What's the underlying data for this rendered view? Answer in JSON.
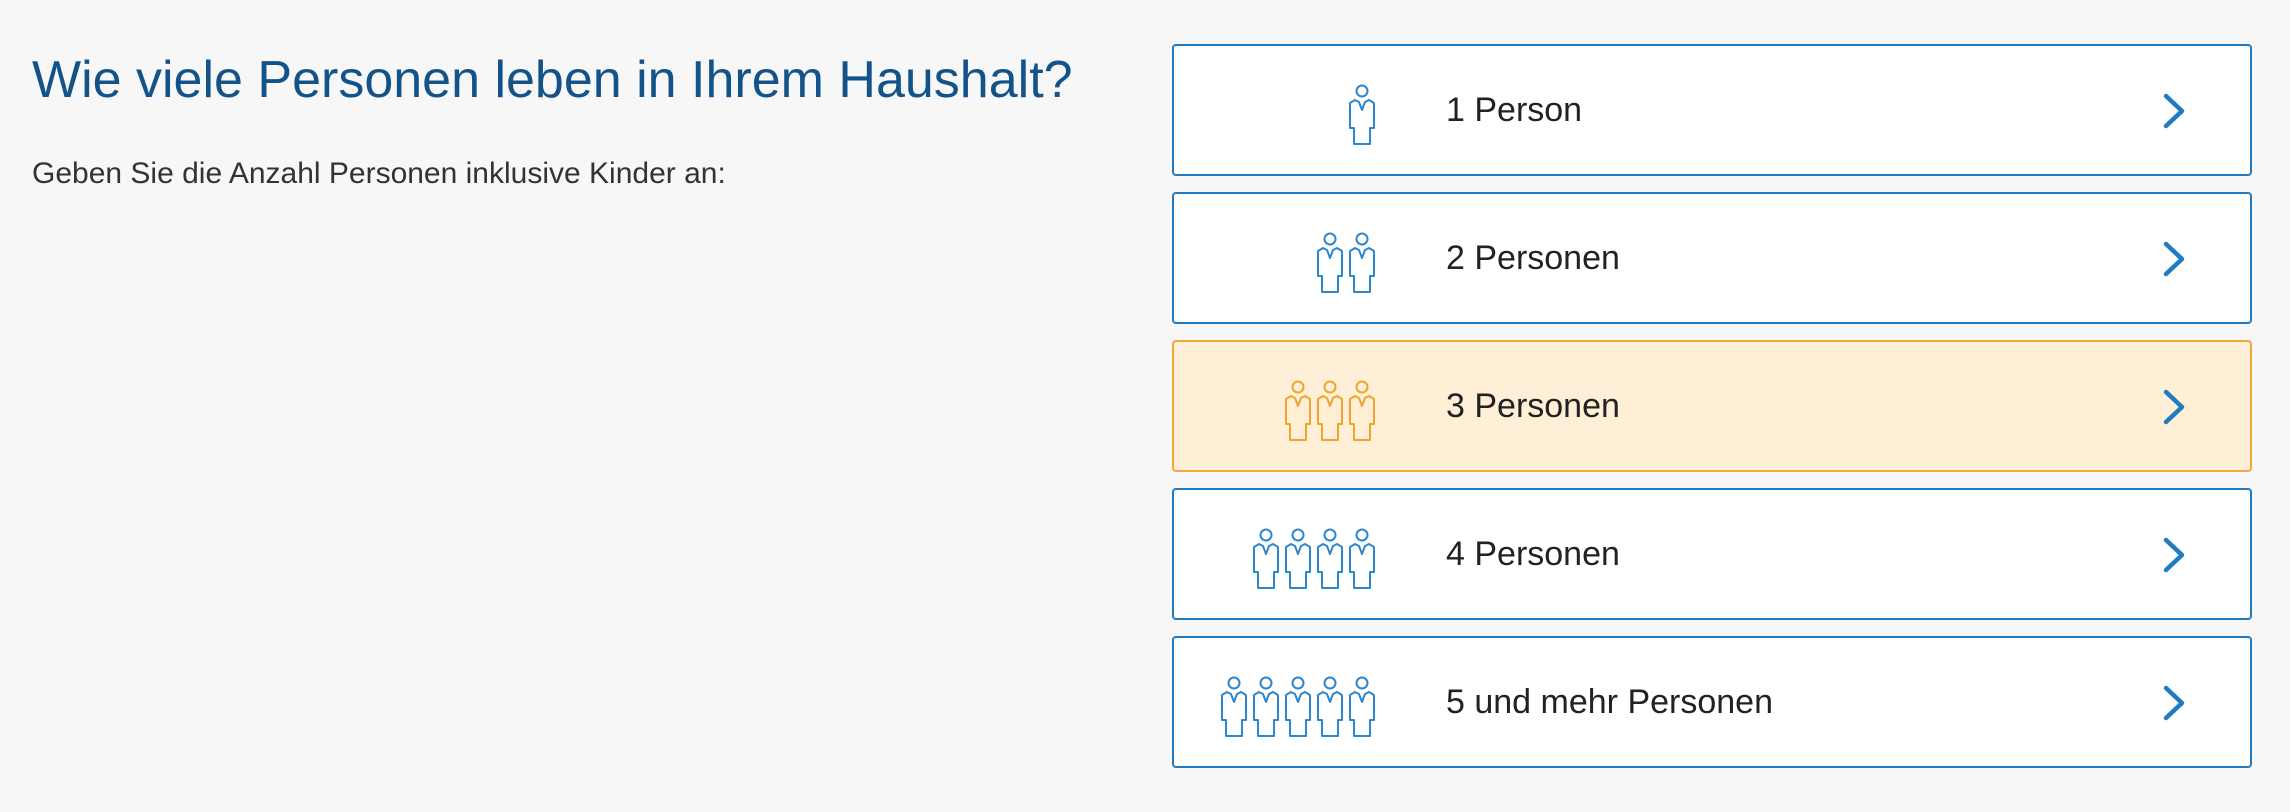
{
  "question": {
    "title": "Wie viele Personen leben in Ihrem Haushalt?",
    "hint": "Geben Sie die Anzahl Personen inklusive Kinder an:"
  },
  "options": [
    {
      "label": "1 Person",
      "people_icon_count": 1,
      "selected": false
    },
    {
      "label": "2 Personen",
      "people_icon_count": 2,
      "selected": false
    },
    {
      "label": "3 Personen",
      "people_icon_count": 3,
      "selected": true
    },
    {
      "label": "4 Personen",
      "people_icon_count": 4,
      "selected": false
    },
    {
      "label": "5 und mehr Personen",
      "people_icon_count": 5,
      "selected": false
    }
  ],
  "icons": {
    "person": "person-icon",
    "arrow": "chevron-right-icon"
  },
  "colors": {
    "title": "#13538a",
    "accent": "#1f7bc2",
    "selected_background": "#feefd6",
    "selected_border": "#f2a93b",
    "selected_icon": "#f0a52c"
  }
}
